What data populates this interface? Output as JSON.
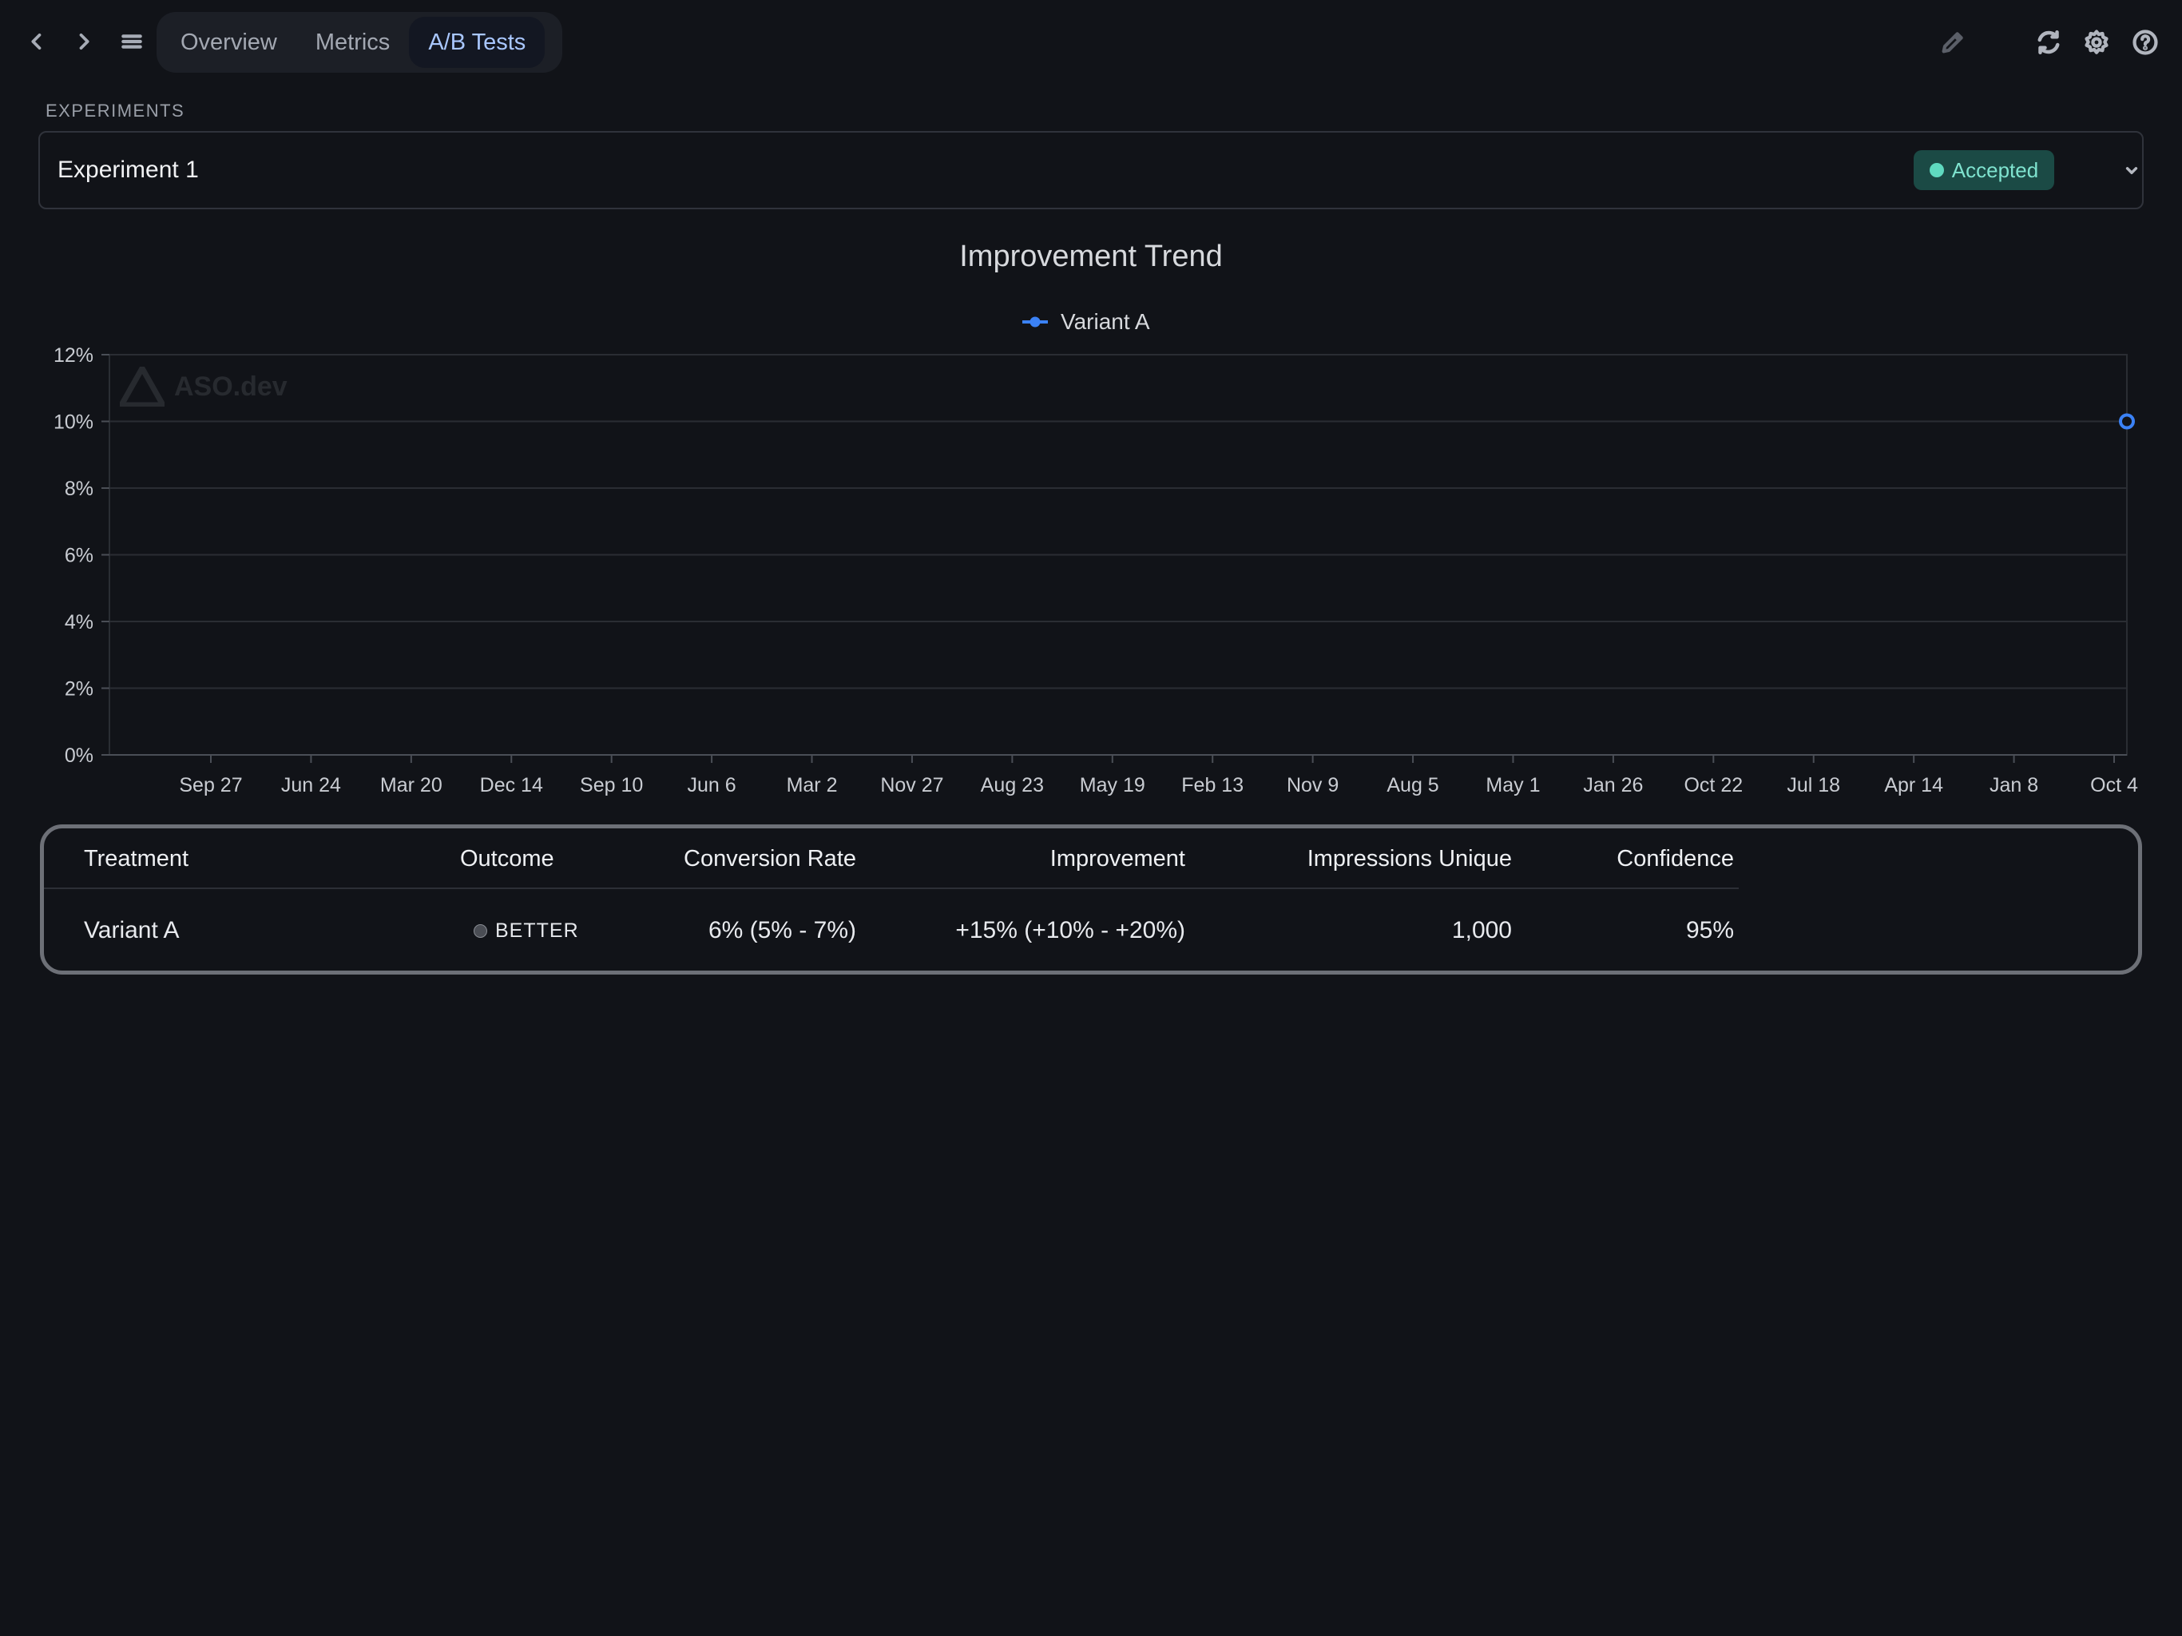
{
  "nav": {
    "tabs": [
      {
        "label": "Overview"
      },
      {
        "label": "Metrics"
      },
      {
        "label": "A/B Tests",
        "active": true
      }
    ],
    "icons": [
      "back-icon",
      "forward-icon",
      "menu-icon",
      "edit-icon",
      "refresh-icon",
      "settings-icon",
      "help-icon"
    ]
  },
  "experiments": {
    "section_label": "EXPERIMENTS",
    "selected": "Experiment 1",
    "status": "Accepted",
    "status_color": "#5fd9bf"
  },
  "watermark": "ASO.dev",
  "chart_data": {
    "type": "line",
    "title": "Improvement Trend",
    "series": [
      {
        "name": "Variant A",
        "color": "#3b82f6",
        "points": [
          {
            "x": "Oct 4",
            "y": 10
          }
        ]
      }
    ],
    "x_ticks": [
      "Sep 27",
      "Jun 24",
      "Mar 20",
      "Dec 14",
      "Sep 10",
      "Jun 6",
      "Mar 2",
      "Nov 27",
      "Aug 23",
      "May 19",
      "Feb 13",
      "Nov 9",
      "Aug 5",
      "May 1",
      "Jan 26",
      "Oct 22",
      "Jul 18",
      "Apr 14",
      "Jan 8",
      "Oct 4"
    ],
    "y_ticks": [
      "0%",
      "2%",
      "4%",
      "6%",
      "8%",
      "10%",
      "12%"
    ],
    "ylim": [
      0,
      12
    ],
    "grid": true,
    "legend_position": "top-center"
  },
  "table": {
    "headers": {
      "treatment": "Treatment",
      "outcome": "Outcome",
      "conversion_rate": "Conversion Rate",
      "improvement": "Improvement",
      "impressions": "Impressions Unique",
      "confidence": "Confidence"
    },
    "rows": [
      {
        "treatment": "Variant A",
        "outcome": "BETTER",
        "conversion_rate": "6% (5% - 7%)",
        "improvement": "+15% (+10% - +20%)",
        "impressions": "1,000",
        "confidence": "95%"
      }
    ]
  }
}
